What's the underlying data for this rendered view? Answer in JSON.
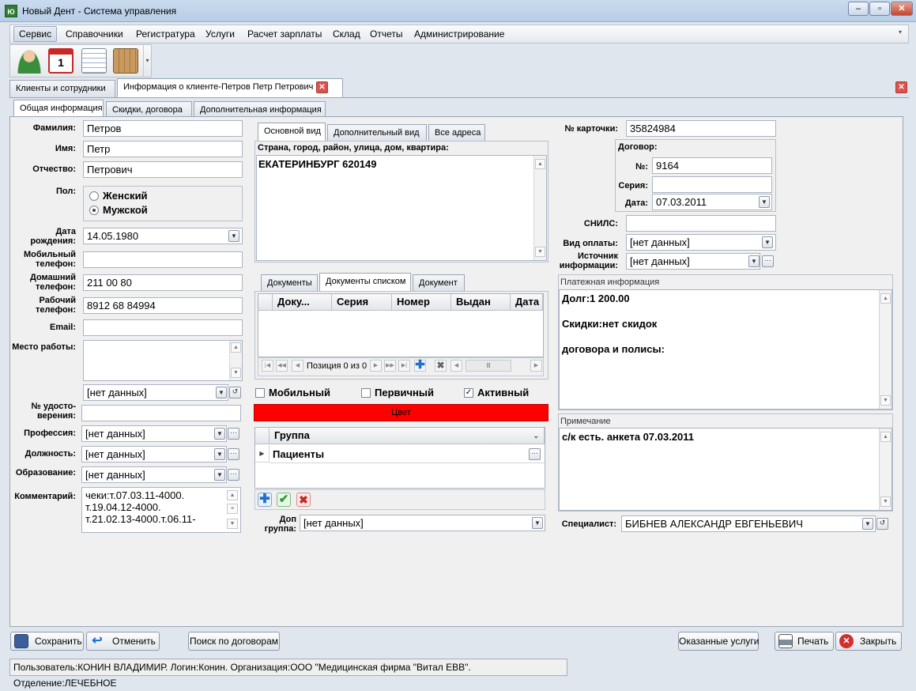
{
  "window": {
    "title": "Новый Дент - Система управления",
    "logo": "Ю"
  },
  "menu": [
    "Сервис",
    "Справочники",
    "Регистратура",
    "Услуги",
    "Расчет зарплаты",
    "Склад",
    "Отчеты",
    "Администрирование"
  ],
  "doc_tabs": [
    "Клиенты и сотрудники",
    "Информация о клиенте-Петров Петр Петрович"
  ],
  "sub_tabs": [
    "Общая информация",
    "Скидки, договора",
    "Дополнительная информация"
  ],
  "client": {
    "surname_label": "Фамилия:",
    "surname": "Петров",
    "name_label": "Имя:",
    "name": "Петр",
    "patronymic_label": "Отчество:",
    "patronymic": "Петрович",
    "sex_label": "Пол:",
    "sex_female": "Женский",
    "sex_male": "Мужской",
    "birth_label": "Дата рождения:",
    "birth": "14.05.1980",
    "mobile_label": "Мобильный телефон:",
    "mobile": "",
    "home_label": "Домашний телефон:",
    "home": "211 00 80",
    "work_label": "Рабочий телефон:",
    "work": "8912 68 84994",
    "email_label": "Email:",
    "email": "",
    "workplace_label": "Место работы:",
    "workplace": "",
    "doc_type": "[нет данных]",
    "idcard_label": "№ удосто-верения:",
    "idcard": "",
    "profession_label": "Профессия:",
    "profession": "[нет данных]",
    "position_label": "Должность:",
    "position": "[нет данных]",
    "education_label": "Образование:",
    "education": "[нет данных]",
    "comment_label": "Комментарий:",
    "comment_lines": [
      "чеки:т.07.03.11-4000.",
      "т.19.04.12-4000.",
      "т.21.02.13-4000.т.06.11-"
    ]
  },
  "address": {
    "tabs": [
      "Основной вид",
      "Дополнительный вид",
      "Все адреса"
    ],
    "caption": "Страна, город, район, улица, дом, квартира:",
    "value": "ЕКАТЕРИНБУРГ  620149"
  },
  "documents": {
    "tabs": [
      "Документы",
      "Документы списком",
      "Документ"
    ],
    "columns": [
      "Доку...",
      "Серия",
      "Номер",
      "Выдан",
      "Дата"
    ],
    "nav_text": "Позиция 0 из 0"
  },
  "flags": {
    "mobile": "Мобильный",
    "primary": "Первичный",
    "active": "Активный"
  },
  "color_bar": {
    "label": "Цвет",
    "color": "#ff0000"
  },
  "groups": {
    "header": "Группа",
    "rows": [
      "Пациенты"
    ],
    "dop_label": "Доп группа:",
    "dop_value": "[нет данных]"
  },
  "card": {
    "card_label": "№ карточки:",
    "card_no": "35824984",
    "contract_title": "Договор:",
    "contract_no_label": "№:",
    "contract_no": "9164",
    "series_label": "Серия:",
    "series": "",
    "date_label": "Дата:",
    "date": "07.03.2011",
    "snils_label": "СНИЛС:",
    "snils": "",
    "payment_label": "Вид оплаты:",
    "payment": "[нет данных]",
    "source_label": "Источник информации:",
    "source": "[нет данных]"
  },
  "payment_info": {
    "title": "Платежная информация",
    "lines": [
      "Долг:1 200.00",
      "",
      "Скидки:нет скидок",
      "",
      "договора и полисы:"
    ]
  },
  "note": {
    "title": "Примечание",
    "text": "с/к есть. анкета 07.03.2011"
  },
  "specialist": {
    "label": "Специалист:",
    "value": "БИБНЕВ АЛЕКСАНДР ЕВГЕНЬЕВИЧ"
  },
  "buttons": {
    "save": "Сохранить",
    "cancel": "Отменить",
    "search": "Поиск по договорам",
    "services": "Оказанные услуги",
    "print": "Печать",
    "close": "Закрыть"
  },
  "status": "Пользователь:КОНИН ВЛАДИМИР. Логин:Конин. Организация:ООО \"Медицинская фирма \"Витал ЕВВ\". Отделение:ЛЕЧЕБНОЕ"
}
